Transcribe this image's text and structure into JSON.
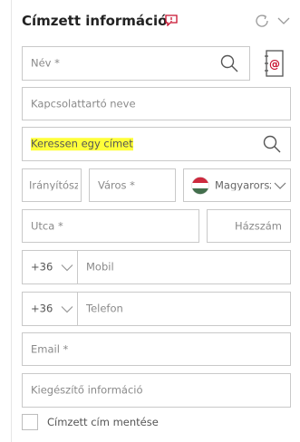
{
  "header": {
    "title": "Címzett információ",
    "title_icon": "comment-alert-icon",
    "refresh_icon": "refresh-icon",
    "collapse_icon": "chevron-down-icon"
  },
  "form": {
    "name_placeholder": "Név *",
    "name_search_icon": "search-icon",
    "address_book_icon": "address-book-icon",
    "contact_placeholder": "Kapcsolattartó neve",
    "address_search_placeholder": "Keressen egy címet",
    "address_search_icon": "search-icon",
    "zip_placeholder": "Irányítósz",
    "city_placeholder": "Város *",
    "country_value": "Magyarország",
    "country_flag_icon": "hungary-flag-icon",
    "street_placeholder": "Utca *",
    "house_number_placeholder": "Házszám",
    "mobile_prefix": "+36",
    "mobile_placeholder": "Mobil",
    "phone_prefix": "+36",
    "phone_placeholder": "Telefon",
    "email_placeholder": "Email *",
    "extra_info_placeholder": "Kiegészítő információ",
    "save_checkbox_label": "Címzett cím mentése"
  },
  "colors": {
    "accent": "#c8102e",
    "highlight": "#ffff3a",
    "border": "#c9c9c9"
  }
}
